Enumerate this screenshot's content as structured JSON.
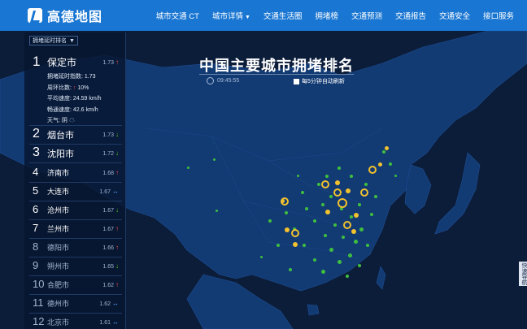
{
  "header": {
    "logo_text": "高德地图",
    "nav": [
      {
        "label": "城市交通 CT"
      },
      {
        "label": "城市详情",
        "dropdown": true
      },
      {
        "label": "交通生活圈"
      },
      {
        "label": "拥堵榜"
      },
      {
        "label": "交通预测"
      },
      {
        "label": "交通报告"
      },
      {
        "label": "交通安全"
      },
      {
        "label": "接口服务"
      }
    ]
  },
  "panel": {
    "header_select": "拥堵延时排名",
    "first": {
      "rank": "1",
      "city": "保定市",
      "value": "1.73",
      "trend": "up",
      "details": {
        "delay_label": "拥堵延时指数:",
        "delay_value": "1.73",
        "wow_label": "周环比数:",
        "wow_value": "10%",
        "avg_speed_label": "平均速度:",
        "avg_speed_value": "24.59 km/h",
        "free_speed_label": "畅通速度:",
        "free_speed_value": "42.6 km/h",
        "weather_label": "天气:",
        "weather_value": "阴"
      }
    },
    "ranks": [
      {
        "rank": "2",
        "city": "烟台市",
        "value": "1.73",
        "trend": "down"
      },
      {
        "rank": "3",
        "city": "沈阳市",
        "value": "1.72",
        "trend": "down"
      },
      {
        "rank": "4",
        "city": "济南市",
        "value": "1.68",
        "trend": "up"
      },
      {
        "rank": "5",
        "city": "大连市",
        "value": "1.67",
        "trend": "flat"
      },
      {
        "rank": "6",
        "city": "沧州市",
        "value": "1.67",
        "trend": "down"
      },
      {
        "rank": "7",
        "city": "兰州市",
        "value": "1.67",
        "trend": "up"
      },
      {
        "rank": "8",
        "city": "德阳市",
        "value": "1.66",
        "trend": "up"
      },
      {
        "rank": "9",
        "city": "朔州市",
        "value": "1.65",
        "trend": "down"
      },
      {
        "rank": "10",
        "city": "合肥市",
        "value": "1.62",
        "trend": "up"
      },
      {
        "rank": "11",
        "city": "德州市",
        "value": "1.62",
        "trend": "flat"
      },
      {
        "rank": "12",
        "city": "北京市",
        "value": "1.61",
        "trend": "flat"
      }
    ]
  },
  "map": {
    "title": "中国主要城市拥堵排名",
    "time": "09:45:55",
    "auto_refresh": "每5分钟自动刷新",
    "side_tab": "快速导航"
  },
  "colors": {
    "topbar": "#1976d2",
    "ocean": "#0c1d3a",
    "land": "#123a73",
    "smooth": "#3fbf3f",
    "congested": "#f2c12e"
  }
}
